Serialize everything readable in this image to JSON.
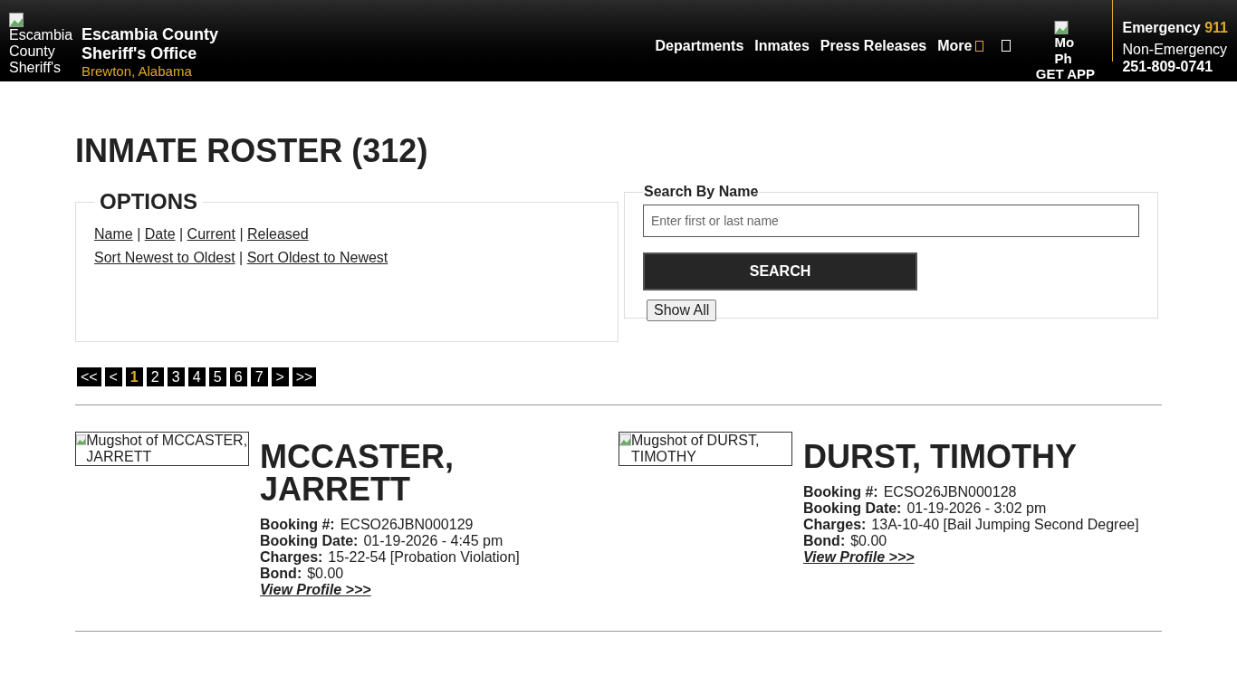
{
  "header": {
    "logo_alt": "Escambia County Sheriff's",
    "site_name": "Escambia County Sheriff's Office",
    "location": "Brewton, Alabama",
    "nav": [
      {
        "label": "Departments"
      },
      {
        "label": "Inmates"
      },
      {
        "label": "Press Releases"
      },
      {
        "label": "More"
      }
    ],
    "app": {
      "image_alt": "Mo Ph",
      "label": "GET APP"
    },
    "emergency": {
      "label": "Emergency",
      "number": "911"
    },
    "non_emergency": {
      "label": "Non-Emergency",
      "number": "251-809-0741"
    }
  },
  "title": "INMATE ROSTER (312)",
  "options": {
    "legend": "OPTIONS",
    "separator": "|",
    "filters": [
      "Name",
      "Date",
      "Current",
      "Released"
    ],
    "sorts": [
      "Sort Newest to Oldest",
      "Sort Oldest to Newest"
    ]
  },
  "search": {
    "legend": "Search By Name",
    "placeholder": "Enter first or last name",
    "button": "SEARCH",
    "show_all": "Show All"
  },
  "pagination": [
    {
      "label": "<<",
      "selected": false
    },
    {
      "label": "<",
      "selected": false
    },
    {
      "label": "1",
      "selected": true
    },
    {
      "label": "2",
      "selected": false
    },
    {
      "label": "3",
      "selected": false
    },
    {
      "label": "4",
      "selected": false
    },
    {
      "label": "5",
      "selected": false
    },
    {
      "label": "6",
      "selected": false
    },
    {
      "label": "7",
      "selected": false
    },
    {
      "label": ">",
      "selected": false
    },
    {
      "label": ">>",
      "selected": false
    }
  ],
  "inmates": [
    {
      "image_alt": "Mugshot of MCCASTER, JARRETT",
      "name": "MCCASTER, JARRETT",
      "fields": [
        {
          "label": "Booking #:",
          "value": "ECSO26JBN000129"
        },
        {
          "label": "Booking Date:",
          "value": "01-19-2026 - 4:45 pm"
        },
        {
          "label": "Charges:",
          "value": "15-22-54 [Probation Violation]"
        },
        {
          "label": "Bond:",
          "value": "$0.00"
        }
      ],
      "link": "View Profile >>>"
    },
    {
      "image_alt": "Mugshot of DURST, TIMOTHY",
      "name": "DURST, TIMOTHY",
      "fields": [
        {
          "label": "Booking #:",
          "value": "ECSO26JBN000128"
        },
        {
          "label": "Booking Date:",
          "value": "01-19-2026 - 3:02 pm"
        },
        {
          "label": "Charges:",
          "value": "13A-10-40 [Bail Jumping Second Degree]"
        },
        {
          "label": "Bond:",
          "value": "$0.00"
        }
      ],
      "link": "View Profile >>>"
    }
  ]
}
